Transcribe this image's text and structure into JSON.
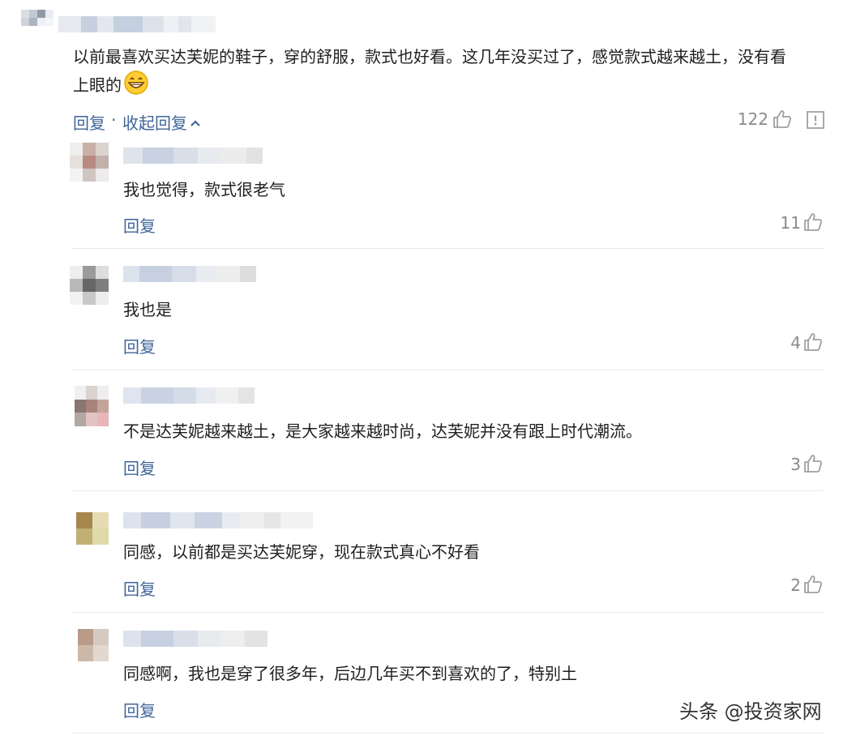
{
  "main_comment": {
    "text_line1": "以前最喜欢买达芙妮的鞋子，穿的舒服，款式也好看。这几年没买过了，感觉款式越来越土，没有看",
    "text_line2": "上眼的",
    "emoji": "grinning-face",
    "reply_label": "回复",
    "separator": "·",
    "collapse_label": "收起回复",
    "like_count": "122"
  },
  "replies": [
    {
      "text": "我也觉得，款式很老气",
      "reply_label": "回复",
      "like_count": "11"
    },
    {
      "text": "我也是",
      "reply_label": "回复",
      "like_count": "4"
    },
    {
      "text": "不是达芙妮越来越土，是大家越来越时尚，达芙妮并没有跟上时代潮流。",
      "reply_label": "回复",
      "like_count": "3"
    },
    {
      "text": "同感，以前都是买达芙妮穿，现在款式真心不好看",
      "reply_label": "回复",
      "like_count": "2"
    },
    {
      "text": "同感啊，我也是穿了很多年，后边几年买不到喜欢的了，特别土",
      "reply_label": "回复"
    }
  ],
  "watermark": "头条 @投资家网",
  "colors": {
    "link": "#406599",
    "count": "#8a8a8a",
    "divider": "#e8e8e8"
  }
}
